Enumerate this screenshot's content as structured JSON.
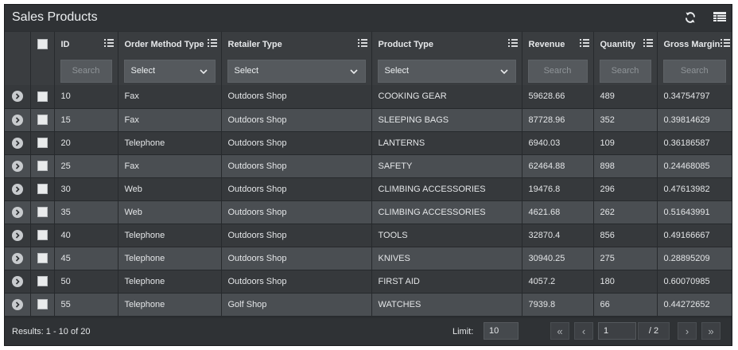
{
  "title": "Sales Products",
  "icons": {
    "refresh": "refresh-icon",
    "columns": "columns-icon"
  },
  "columns": [
    "ID",
    "Order Method Type",
    "Retailer Type",
    "Product Type",
    "Revenue",
    "Quantity",
    "Gross Margin"
  ],
  "filters": {
    "id": {
      "kind": "search",
      "placeholder": "Search"
    },
    "order_method": {
      "kind": "select",
      "value": "Select"
    },
    "retailer": {
      "kind": "select",
      "value": "Select"
    },
    "product": {
      "kind": "select",
      "value": "Select"
    },
    "revenue": {
      "kind": "search",
      "placeholder": "Search"
    },
    "quantity": {
      "kind": "search",
      "placeholder": "Search"
    },
    "margin": {
      "kind": "search",
      "placeholder": "Search"
    }
  },
  "rows": [
    [
      "10",
      "Fax",
      "Outdoors Shop",
      "COOKING GEAR",
      "59628.66",
      "489",
      "0.34754797"
    ],
    [
      "15",
      "Fax",
      "Outdoors Shop",
      "SLEEPING BAGS",
      "87728.96",
      "352",
      "0.39814629"
    ],
    [
      "20",
      "Telephone",
      "Outdoors Shop",
      "LANTERNS",
      "6940.03",
      "109",
      "0.36186587"
    ],
    [
      "25",
      "Fax",
      "Outdoors Shop",
      "SAFETY",
      "62464.88",
      "898",
      "0.24468085"
    ],
    [
      "30",
      "Web",
      "Outdoors Shop",
      "CLIMBING ACCESSORIES",
      "19476.8",
      "296",
      "0.47613982"
    ],
    [
      "35",
      "Web",
      "Outdoors Shop",
      "CLIMBING ACCESSORIES",
      "4621.68",
      "262",
      "0.51643991"
    ],
    [
      "40",
      "Telephone",
      "Outdoors Shop",
      "TOOLS",
      "32870.4",
      "856",
      "0.49166667"
    ],
    [
      "45",
      "Telephone",
      "Outdoors Shop",
      "KNIVES",
      "30940.25",
      "275",
      "0.28895209"
    ],
    [
      "50",
      "Telephone",
      "Outdoors Shop",
      "FIRST AID",
      "4057.2",
      "180",
      "0.60070985"
    ],
    [
      "55",
      "Telephone",
      "Golf Shop",
      "WATCHES",
      "7939.8",
      "66",
      "0.44272652"
    ]
  ],
  "footer": {
    "results": "Results: 1 - 10 of 20",
    "limit_label": "Limit:",
    "limit_value": "10",
    "first": "«",
    "prev": "‹",
    "page": "1",
    "page_total": "/ 2",
    "next": "›",
    "last": "»"
  },
  "colors": {
    "panel": "#2b2e31",
    "row_odd": "#36393c",
    "row_even": "#4a4e52",
    "header": "#3a3d40"
  }
}
